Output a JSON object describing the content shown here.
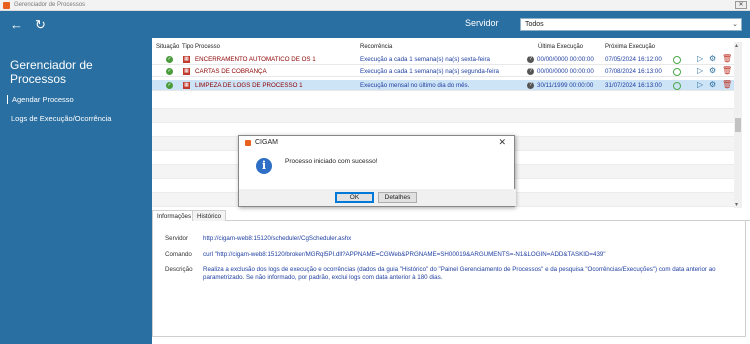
{
  "window": {
    "title": "Gerenciador de Processos",
    "close_label": "✕"
  },
  "header": {
    "back_icon": "←",
    "refresh_icon": "↻",
    "server_label": "Servidor",
    "server_value": "Todos",
    "dropdown_arrow": "⌄"
  },
  "sidebar": {
    "heading": "Gerenciador de Processos",
    "items": [
      {
        "label": "Agendar Processo",
        "active": true
      },
      {
        "label": "Logs de Execução/Ocorrência",
        "active": false
      }
    ]
  },
  "grid": {
    "columns": [
      "Situação",
      "Tipo",
      "Processo",
      "Recorrência",
      "Última Execução",
      "Próxima Execução"
    ],
    "rows": [
      {
        "process": "ENCERRAMENTO AUTOMATICO DE OS 1",
        "recurrence": "Execução a cada 1 semana(s) na(s) sexta-feira",
        "last": "00/00/0000 00:00:00",
        "next": "07/05/2024 16:12:00",
        "selected": false
      },
      {
        "process": "CARTAS DE COBRANÇA",
        "recurrence": "Execução a cada 1 semana(s) na(s) segunda-feira",
        "last": "00/00/0000 00:00:00",
        "next": "07/08/2024 16:13:00",
        "selected": false
      },
      {
        "process": "LIMPEZA DE LOGS DE PROCESSO 1",
        "recurrence": "Execução mensal no último dia do mês.",
        "last": "30/11/1999 00:00:00",
        "next": "31/07/2024 16:13:00",
        "selected": true
      }
    ]
  },
  "tabs": [
    {
      "label": "Informações",
      "active": true
    },
    {
      "label": "Histórico",
      "active": false
    }
  ],
  "info": {
    "server_label": "Servidor",
    "server_value": "http://cigam-web8:15120/scheduler/CgScheduler.ashx",
    "command_label": "Comando",
    "command_value": "curl \"http://cigam-web8:15120/broker/MGRql5PI.dll?APPNAME=CGWeb&PRGNAME=SH00019&ARGUMENTS=-N1&LOGIN=ADD&TASKID=439\"",
    "description_label": "Descrição",
    "description_value": "Realiza a exclusão dos logs de execução e ocorrências (dados da guia \"Histórico\" do \"Painel Gerenciamento de Processos\" e da pesquisa \"Ocorrências/Execuções\") com data anterior ao parametrizado. Se não informado, por padrão, exclui logs com data anterior à 180 dias."
  },
  "dialog": {
    "title": "CIGAM",
    "message": "Processo iniciado com sucesso!",
    "ok_label": "OK",
    "details_label": "Detalhes",
    "close_label": "✕"
  }
}
